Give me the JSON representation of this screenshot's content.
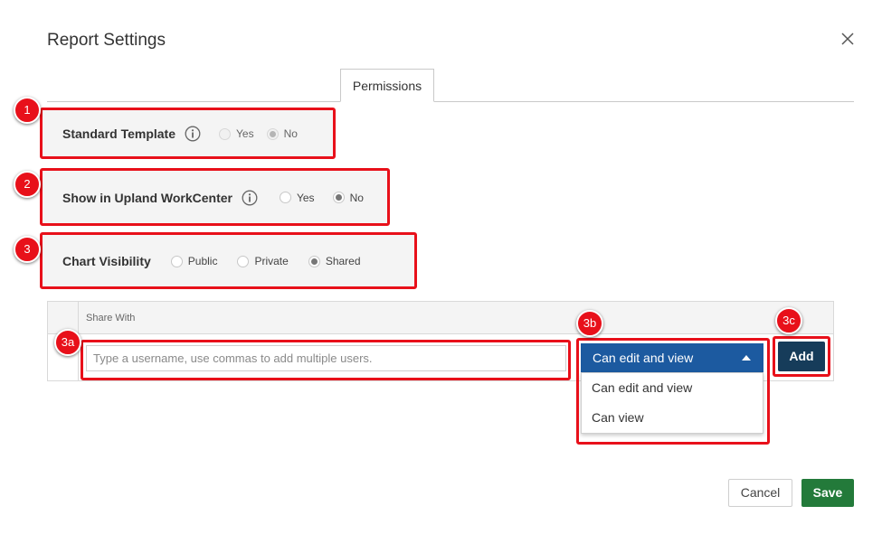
{
  "dialog": {
    "title": "Report Settings"
  },
  "tabs": [
    {
      "label": "Permissions",
      "active": true
    }
  ],
  "settings": {
    "standard_template": {
      "label": "Standard Template",
      "options": [
        "Yes",
        "No"
      ],
      "selected": "No",
      "disabled": true
    },
    "show_in_workcenter": {
      "label": "Show in Upland WorkCenter",
      "options": [
        "Yes",
        "No"
      ],
      "selected": "No"
    },
    "chart_visibility": {
      "label": "Chart Visibility",
      "options": [
        "Public",
        "Private",
        "Shared"
      ],
      "selected": "Shared"
    }
  },
  "share": {
    "header": "Share With",
    "input_placeholder": "Type a username, use commas to add multiple users.",
    "input_value": "",
    "permission_selected": "Can edit and view",
    "permission_options": [
      "Can edit and view",
      "Can view"
    ],
    "add_label": "Add"
  },
  "footer": {
    "cancel_label": "Cancel",
    "save_label": "Save"
  },
  "annotations": {
    "callouts": [
      "1",
      "2",
      "3",
      "3a",
      "3b",
      "3c"
    ],
    "highlight_color": "#e8101a"
  },
  "colors": {
    "primary_blue": "#1c5aa0",
    "add_button": "#163c5a",
    "save_green": "#237a3a",
    "row_background": "#f4f4f4"
  }
}
